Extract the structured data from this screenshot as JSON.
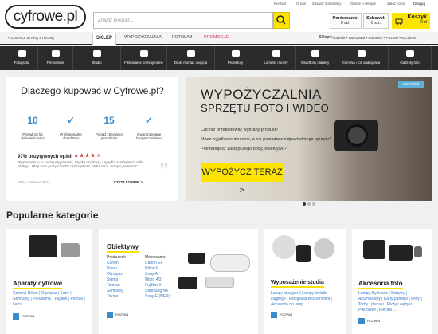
{
  "header": {
    "logo": "cyfrowe.pl",
    "search_placeholder": "Znajdź produkt...",
    "top_links": [
      "Kontakt",
      "O nas",
      "Zasady sprzedaży",
      "Opinie o sklepie",
      "Załóż konto",
      "Zaloguj"
    ],
    "compare": {
      "label": "Porównanie:",
      "count": "0 szt."
    },
    "wishlist": {
      "label": "Schowek",
      "count": "0 szt."
    },
    "cart": {
      "label": "Koszyk",
      "value": "0 zł"
    }
  },
  "nav": {
    "back": "< ZOBACZ STARĄ STRONĘ",
    "tabs": [
      "SKLEP",
      "WYPOŻYCZALNIA",
      "FOTOLAB",
      "PROMOCJE"
    ],
    "stores_label": "Sklepy:",
    "stores": "Gdańsk • Warszawa • Katowice • Poznań • Szczecin"
  },
  "categories": [
    "Fotografia",
    "Filmowanie",
    "Studio",
    "Filmowanie profesjonalne",
    "Druk, montaż i edycja",
    "Projektory",
    "Lornetki i lunety",
    "Smartfony i tablety",
    "Ciemnia i fot. analogowa",
    "Gadżety foto"
  ],
  "why": {
    "title": "Dlaczego kupować w Cyfrowe.pl?",
    "badges": [
      {
        "big": "10",
        "text": "Ponad 10 lat doświadczenia"
      },
      {
        "big": "✓",
        "text": "Profesjonalne doradztwo"
      },
      {
        "big": "15",
        "text": "Ponad 15 tysięcy produktów"
      },
      {
        "big": "✓",
        "text": "Gwarantowane bezpieczeństwo"
      }
    ],
    "rating": "97% pozytywnych opinii",
    "quote": "\"Kupowanie tu to sama przyjemność, szybka realizacja i wysyłka zamówienia, miła obsługa. Długi czas pracy i bardzo dobra jakość, niska cena. Gorąco polecam!\"",
    "author": "Basia, czerwiec 2014",
    "read_more": "CZYTAJ OPINIE >"
  },
  "banner": {
    "badge": "NOWOŚĆ",
    "title1": "WYPOŻYCZALNIA",
    "title2": "SPRZĘTU FOTO I WIDEO",
    "lines": [
      "Chcesz przetestować wybrany produkt?",
      "Masz wyjątkowe zlecenie, a nie posiadasz odpowiedniego sprzętu?",
      "Potrzebujesz zastępczego body, obiektywu?"
    ],
    "button": "WYPOŻYCZ TERAZ >"
  },
  "popular": {
    "title": "Popularne kategorie",
    "cards": [
      {
        "title": "Aparaty cyfrowe",
        "links": "Canon | Nikon | Olympus | Sony | Samsung | Panasonic | Fujifilm | Pentax | Leica ...",
        "more": "ROZWIŃ"
      },
      {
        "title": "Obiektywy",
        "col1_label": "Producent:",
        "col1": [
          "Canon",
          "Nikon",
          "Olympus",
          "Sigma",
          "Tamron",
          "Samsung",
          "Tokina ..."
        ],
        "col2_label": "Mocowanie:",
        "col2": [
          "Canon EF",
          "Nikon F",
          "Sony A",
          "Micro 4/3",
          "Fujifilm X",
          "Samsung NX",
          "Sony E (NEX) ..."
        ],
        "more": "ROZWIŃ"
      },
      {
        "title": "Wyposażenie studia",
        "links": "Lampy studyjne | Lampy światła ciągłego | Fotografia bezcieniowa | Akcesoria do lamp ...",
        "more": "ROZWIŃ"
      },
      {
        "title": "Akcesoria foto",
        "links": "Lampy błyskowe | Statywy | Akumulatory | Karty pamięci | Filtry | Torby i plecaki | Piloty i wężyki | Pokrowce | Plecaki ...",
        "more": "ROZWIŃ"
      }
    ]
  }
}
